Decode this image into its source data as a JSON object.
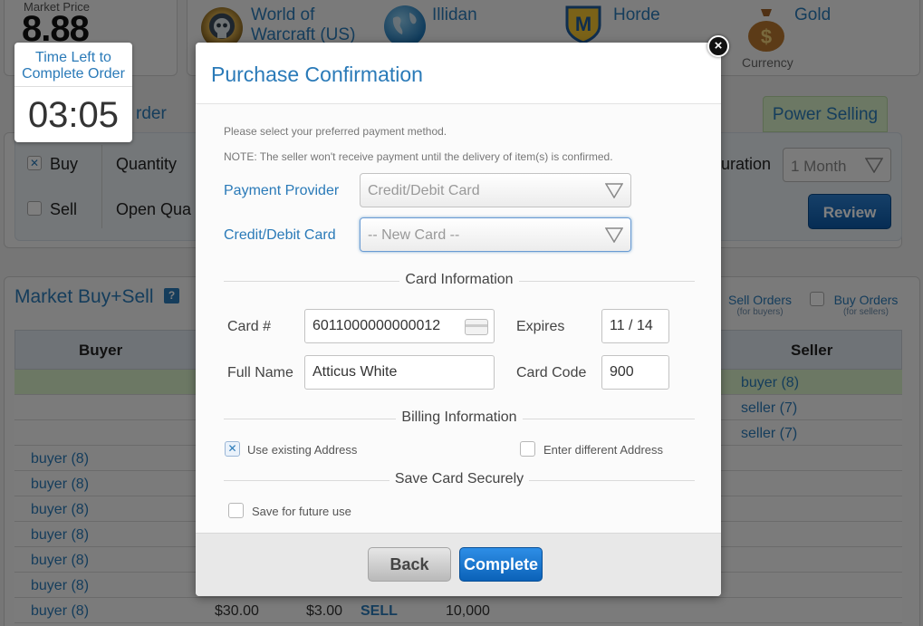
{
  "header": {
    "market_price_label": "Market Price",
    "market_price_value": "8.88",
    "game": "World of Warcraft (US)",
    "server": "Illidan",
    "faction": "Horde",
    "item": "Gold",
    "item_sub": "Currency"
  },
  "timer": {
    "label": "Time Left to Complete Order",
    "value": "03:05"
  },
  "order_form": {
    "tab_partial": "rder",
    "power_tab": "Power Selling",
    "buy_label": "Buy",
    "sell_label": "Sell",
    "quantity_label": "Quantity",
    "open_qty_label": "Open Qua",
    "duration_partial": "uration",
    "duration_value": "1 Month",
    "review_button": "Review"
  },
  "market": {
    "title": "Market Buy+Sell",
    "help": "?",
    "sell_orders": "Sell Orders",
    "sell_orders_sub": "(for buyers)",
    "buy_orders": "Buy Orders",
    "buy_orders_sub": "(for sellers)",
    "col_buyer": "Buyer",
    "col_seller": "Seller",
    "seller_rows": [
      "buyer (8)",
      "seller (7)",
      "seller (7)"
    ],
    "buyer_rows": [
      "buyer (8)",
      "buyer (8)",
      "buyer (8)",
      "buyer (8)",
      "buyer (8)",
      "buyer (8)",
      "buyer (8)"
    ],
    "last_row": {
      "price": "$30.00",
      "unit": "$3.00",
      "action": "SELL",
      "qty": "10,000"
    }
  },
  "modal": {
    "title": "Purchase Confirmation",
    "note1": "Please select your preferred payment method.",
    "note2": "NOTE: The seller won't receive payment until the delivery of item(s) is confirmed.",
    "payment_provider_label": "Payment Provider",
    "payment_provider_value": "Credit/Debit Card",
    "card_label": "Credit/Debit Card",
    "card_value": "-- New Card --",
    "card_info_heading": "Card Information",
    "card_num_label": "Card #",
    "card_num_value": "6011000000000012",
    "expires_label": "Expires",
    "expires_value": "11 / 14",
    "full_name_label": "Full Name",
    "full_name_value": "Atticus White",
    "card_code_label": "Card Code",
    "card_code_value": "900",
    "billing_heading": "Billing Information",
    "use_existing_label": "Use existing Address",
    "enter_different_label": "Enter different Address",
    "save_heading": "Save Card Securely",
    "save_future_label": "Save for future use",
    "back_button": "Back",
    "complete_button": "Complete",
    "close_glyph": "×",
    "check_glyph": "✕"
  },
  "colors": {
    "accent": "#2a7ab8",
    "primary_button": "#1a73c8",
    "power_selling_bg": "#d8f0c8"
  },
  "icons": [
    "wow-emblem-icon",
    "globe-icon",
    "horde-shield-icon",
    "gold-bag-icon",
    "credit-card-icon",
    "dropdown-triangle-icon",
    "close-icon",
    "help-icon"
  ]
}
